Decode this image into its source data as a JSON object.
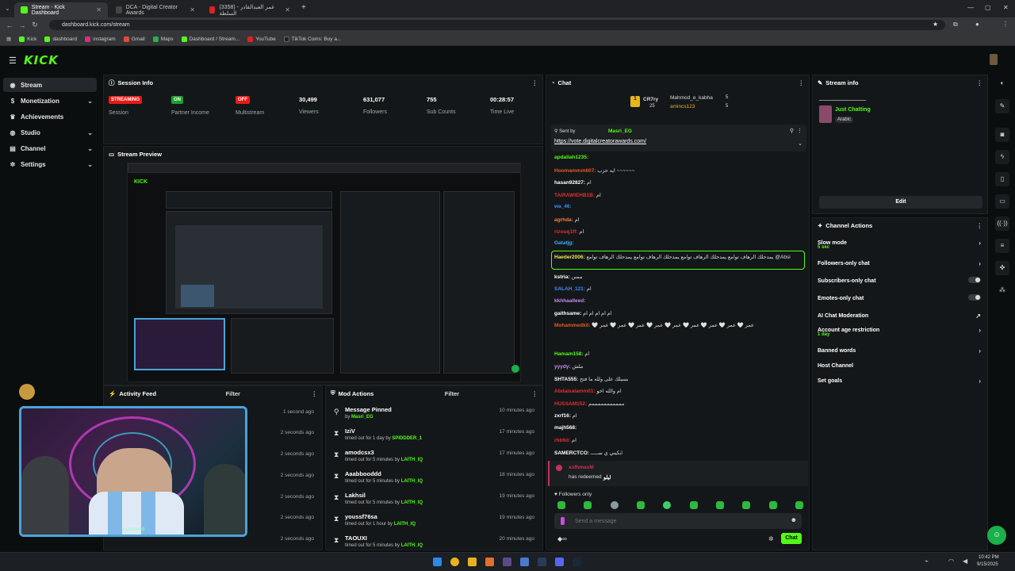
{
  "browser": {
    "tabs": [
      {
        "title": "Stream - Kick Dashboard",
        "active": true
      },
      {
        "title": "DCA - Digital Creator Awards",
        "active": false
      },
      {
        "title": "(3358) عمر العبدالقادر - السلطة",
        "active": false
      }
    ],
    "url": "dashboard.kick.com/stream",
    "bookmarks": [
      "Kick",
      "dashboard",
      "instagram",
      "Gmail",
      "Maps",
      "Dashboard / Stream...",
      "YouTube",
      "TikTok Coins: Buy a..."
    ]
  },
  "app": {
    "logo": "KICK"
  },
  "sidebar": {
    "items": [
      {
        "label": "Stream",
        "icon": "broadcast-icon",
        "active": true,
        "chevron": false
      },
      {
        "label": "Monetization",
        "icon": "dollar-icon",
        "active": false,
        "chevron": true
      },
      {
        "label": "Achievements",
        "icon": "trophy-icon",
        "active": false,
        "chevron": false
      },
      {
        "label": "Studio",
        "icon": "studio-icon",
        "active": false,
        "chevron": true
      },
      {
        "label": "Channel",
        "icon": "channel-icon",
        "active": false,
        "chevron": true
      },
      {
        "label": "Settings",
        "icon": "gear-icon",
        "active": false,
        "chevron": true
      }
    ]
  },
  "session_info": {
    "title": "Session Info",
    "stats": [
      {
        "value": "STREAMING",
        "label": "Session",
        "badge": true,
        "color": "#e91916"
      },
      {
        "value": "ON",
        "label": "Partner Income",
        "badge": true,
        "color": "#1f9e2a"
      },
      {
        "value": "OFF",
        "label": "Multistream",
        "badge": true,
        "color": "#e91916"
      },
      {
        "value": "30,499",
        "label": "Viewers",
        "badge": false
      },
      {
        "value": "631,077",
        "label": "Followers",
        "badge": false
      },
      {
        "value": "755",
        "label": "Sub Counts",
        "badge": false
      },
      {
        "value": "00:28:57",
        "label": "Time Live",
        "badge": false
      }
    ]
  },
  "stream_preview": {
    "title": "Stream Preview"
  },
  "activity_feed": {
    "title": "Activity Feed",
    "filter": "Filter",
    "rows": [
      {
        "time": "1 second ago"
      },
      {
        "time": "2 seconds ago"
      },
      {
        "time": "2 seconds ago"
      },
      {
        "time": "2 seconds ago"
      },
      {
        "time": "2 seconds ago"
      },
      {
        "time": "2 seconds ago"
      },
      {
        "time": "2 seconds ago"
      }
    ],
    "overlay_text": "redeemed"
  },
  "mod_actions": {
    "title": "Mod Actions",
    "filter": "Filter",
    "rows": [
      {
        "title": "Message Pinned",
        "pre": "by",
        "by": "Masri_EG",
        "time": "10 minutes ago",
        "icon": "pin-icon"
      },
      {
        "title": "IziV",
        "pre": "timed out for 1 day by",
        "by": "SPIDDDER_1",
        "time": "17 minutes ago",
        "icon": "hourglass-icon"
      },
      {
        "title": "amodcsx3",
        "pre": "timed out for 5 minutes by",
        "by": "LAITH_IQ",
        "time": "17 minutes ago",
        "icon": "hourglass-icon"
      },
      {
        "title": "Aaabbooddd",
        "pre": "timed out for 5 minutes by",
        "by": "LAITH_IQ",
        "time": "18 minutes ago",
        "icon": "hourglass-icon"
      },
      {
        "title": "Lakhsil",
        "pre": "timed out for 5 minutes by",
        "by": "LAITH_IQ",
        "time": "19 minutes ago",
        "icon": "hourglass-icon"
      },
      {
        "title": "youssf76sa",
        "pre": "timed out for 1 hour by",
        "by": "LAITH_IQ",
        "time": "19 minutes ago",
        "icon": "hourglass-icon"
      },
      {
        "title": "TAOUXI",
        "pre": "timed out for 5 minutes by",
        "by": "LAITH_IQ",
        "time": "20 minutes ago",
        "icon": "hourglass-icon"
      }
    ]
  },
  "chat": {
    "title": "Chat",
    "top_gifters": [
      {
        "name": "CR7ry",
        "count": "25"
      },
      {
        "name": "Mahmod_e_kabha",
        "count": "5"
      },
      {
        "name": "amincs123",
        "count": "5"
      }
    ],
    "pinned": {
      "sent_by": "Sent by",
      "sender": "Masri_EG",
      "link": "https://vote.digitalcreatorawards.com/"
    },
    "messages": [
      {
        "user": "apdallah1235:",
        "text": "",
        "color": "#53fc18"
      },
      {
        "user": "Hoomammm607:",
        "text": "ايه حزب ~~~~~~",
        "color": "#e05c2c"
      },
      {
        "user": "hasan92827:",
        "text": "ام",
        "color": "#ffffff"
      },
      {
        "user": "TAIRAWIEHB1B:",
        "text": "ام",
        "color": "#e0302c"
      },
      {
        "user": "wa_46:",
        "text": "",
        "color": "#3f8ef5"
      },
      {
        "user": "agrhda:",
        "text": "ام",
        "color": "#ff7a3a"
      },
      {
        "user": "rizouq1ff:",
        "text": "ام",
        "color": "#e0302c"
      },
      {
        "user": "Gatatjg:",
        "text": "",
        "color": "#3fb0f5"
      },
      {
        "user": "Haeder2006:",
        "text": "يمدحلك الرهاف توامع يمدحلك الرهاف توامع يمدحلك الرهاف توامع يمدحلك الرهاف توامع @Absi",
        "color": "#e8e85a",
        "highlight": true
      },
      {
        "user": "kstria:",
        "text": "ممنن",
        "color": "#ffffff"
      },
      {
        "user": "SALAH_121:",
        "text": "ام",
        "color": "#3f8ef5"
      },
      {
        "user": "kkhhaalleed:",
        "text": "",
        "color": "#c88af5"
      },
      {
        "user": "gaithsame:",
        "text": "ام ام ام ام ام",
        "color": "#ffffff"
      },
      {
        "user": "Mohammedkil:",
        "text": "🤍 عمر 🤍 عمر 🤍 عمر 🤍 عمر 🤍 عمر 🤍 عمر 🤍 عمر 🤍 عمر 🤍 عمر",
        "color": "#e05c2c"
      },
      {
        "user": "Hamam158:",
        "text": "ام",
        "color": "#53fc18"
      },
      {
        "user": "yyydy:",
        "text": "ملش",
        "color": "#c88af5"
      },
      {
        "user": "SHTA555:",
        "text": "بسيلك على ولله ما فتح",
        "color": "#ffffff"
      },
      {
        "user": "Abdalsalamm01:",
        "text": "ام والله اخو",
        "color": "#e0302c"
      },
      {
        "user": "HUSSAM152:",
        "text": "مممممممممممم",
        "color": "#e0302c"
      },
      {
        "user": "zxrf16:",
        "text": "ام",
        "color": "#ffffff"
      },
      {
        "user": "majh568:",
        "text": "",
        "color": "#ffffff"
      },
      {
        "user": "rhb6d:",
        "text": "ام",
        "color": "#e0302c"
      },
      {
        "user": "SAMERCTCO:",
        "text": "ابكيني ي ســـــ",
        "color": "#ffffff"
      }
    ],
    "redeem": {
      "user": "xsfhmasM",
      "text": "has redeemed",
      "item": "ليلو"
    },
    "followers_only": "Followers only",
    "send_placeholder": "Send a message",
    "send_button": "Chat"
  },
  "stream_info": {
    "title": "Stream info",
    "stream_title": "ـــــــــــــــــــــــــــــــ",
    "category": "Just Chatting",
    "language": "Arabic",
    "edit": "Edit"
  },
  "channel_actions": {
    "title": "Channel Actions",
    "items": [
      {
        "label": "Slow mode",
        "sub": "5 sec",
        "control": "chevron"
      },
      {
        "label": "Followers-only chat",
        "sub": "",
        "control": "chevron"
      },
      {
        "label": "Subscribers-only chat",
        "sub": "",
        "control": "toggle"
      },
      {
        "label": "Emotes-only chat",
        "sub": "",
        "control": "toggle"
      },
      {
        "label": "AI Chat Moderation",
        "sub": "",
        "control": "external"
      },
      {
        "label": "Account age restriction",
        "sub": "1 day",
        "control": "chevron"
      },
      {
        "label": "Banned words",
        "sub": "",
        "control": "chevron"
      },
      {
        "label": "Host Channel",
        "sub": "",
        "control": "none"
      },
      {
        "label": "Set goals",
        "sub": "",
        "control": "chevron"
      }
    ]
  },
  "taskbar": {
    "time": "10:42 PM",
    "date": "9/15/2025"
  },
  "colors": {
    "accent": "#53fc18",
    "panel": "#141719",
    "bg": "#0b0e0f"
  }
}
